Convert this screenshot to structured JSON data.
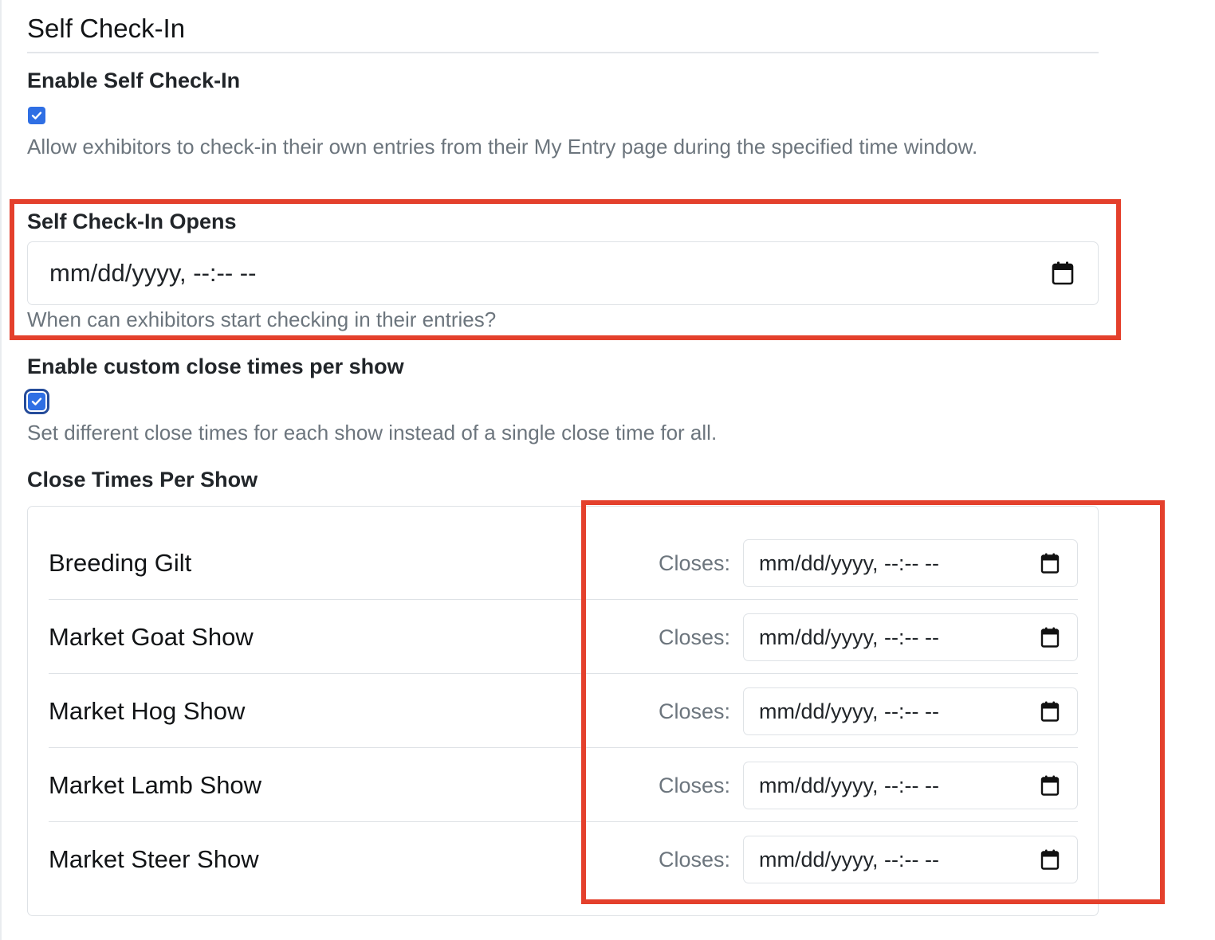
{
  "section": {
    "title": "Self Check-In"
  },
  "enable_self_checkin": {
    "label": "Enable Self Check-In",
    "checked": true,
    "help_text": "Allow exhibitors to check-in their own entries from their My Entry page during the specified time window."
  },
  "self_checkin_opens": {
    "label": "Self Check-In Opens",
    "placeholder": "mm/dd/yyyy, --:-- --",
    "help_text": "When can exhibitors start checking in their entries?"
  },
  "custom_close_times": {
    "label": "Enable custom close times per show",
    "checked": true,
    "help_text": "Set different close times for each show instead of a single close time for all."
  },
  "close_times_per_show": {
    "label": "Close Times Per Show",
    "closes_label": "Closes:",
    "placeholder": "mm/dd/yyyy, --:-- --",
    "shows": [
      {
        "name": "Breeding Gilt"
      },
      {
        "name": "Market Goat Show"
      },
      {
        "name": "Market Hog Show"
      },
      {
        "name": "Market Lamb Show"
      },
      {
        "name": "Market Steer Show"
      }
    ]
  },
  "icons": {
    "checkbox_check": "check-icon",
    "calendar": "calendar-icon"
  },
  "colors": {
    "checkbox_accent": "#2f6fe4",
    "annotation_highlight": "#e4402c",
    "help_text": "#6c757d"
  }
}
